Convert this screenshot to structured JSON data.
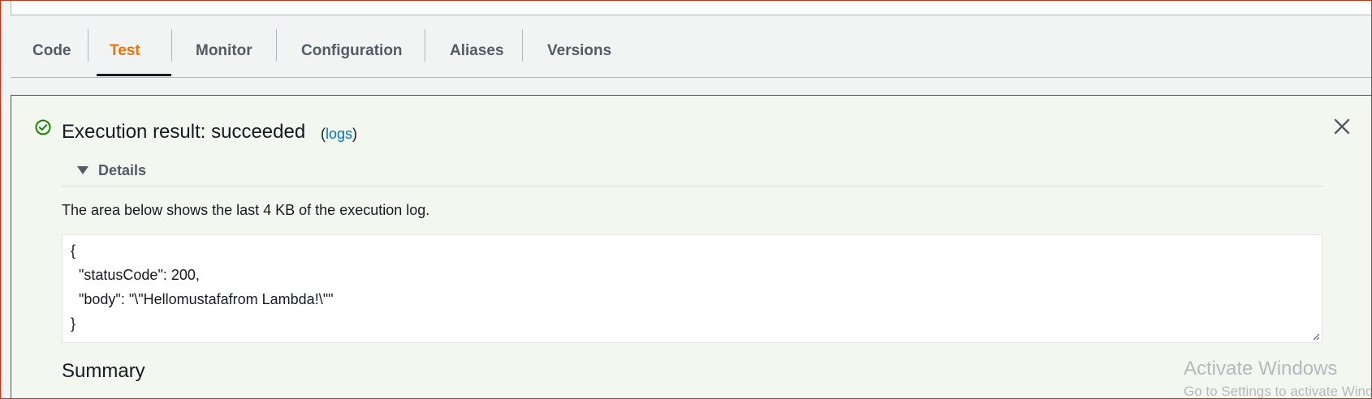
{
  "tabs": [
    {
      "label": "Code"
    },
    {
      "label": "Test",
      "active": true
    },
    {
      "label": "Monitor"
    },
    {
      "label": "Configuration"
    },
    {
      "label": "Aliases"
    },
    {
      "label": "Versions"
    }
  ],
  "result": {
    "title": "Execution result: succeeded",
    "logs_open": "(",
    "logs_link": "logs",
    "logs_close": ")",
    "status_color": "#1d8102"
  },
  "details": {
    "label": "Details",
    "info": "The area below shows the last 4 KB of the execution log.",
    "log_lines": [
      "{",
      "  \"statusCode\": 200,",
      "  \"body\": \"\\\"Hellomustafafrom Lambda!\\\"\"",
      "}"
    ]
  },
  "summary": {
    "title": "Summary"
  },
  "watermark": {
    "line1": "Activate Windows",
    "line2": "Go to Settings to activate Windows."
  },
  "colors": {
    "accent": "#ec7211",
    "link": "#0073bb",
    "success": "#1d8102"
  }
}
